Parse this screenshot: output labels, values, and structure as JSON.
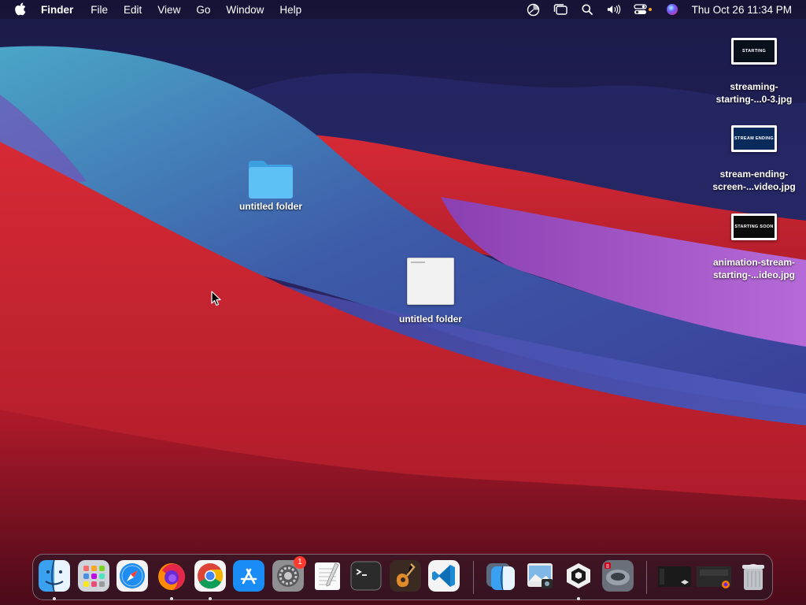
{
  "menubar": {
    "app_name": "Finder",
    "items": [
      "File",
      "Edit",
      "View",
      "Go",
      "Window",
      "Help"
    ],
    "status_icons": [
      "screen-time-icon",
      "stage-manager-icon",
      "search-icon",
      "volume-icon",
      "control-center-icon",
      "siri-icon"
    ],
    "clock": "Thu Oct 26  11:34 PM"
  },
  "desktop": {
    "folder1": {
      "label": "untitled folder"
    },
    "folder2": {
      "label": "untitled folder"
    },
    "files": [
      {
        "line1": "streaming-",
        "line2": "starting-...0-3.jpg",
        "thumb_text": "STARTING",
        "thumb_color": "#0a0f1c"
      },
      {
        "line1": "stream-ending-",
        "line2": "screen-...video.jpg",
        "thumb_text": "STREAM ENDING",
        "thumb_color": "#0a2a5c"
      },
      {
        "line1": "animation-stream-",
        "line2": "starting-...ideo.jpg",
        "thumb_text": "STARTING SOON",
        "thumb_color": "#0c0c0c"
      }
    ]
  },
  "dock": {
    "apps": [
      "finder-icon",
      "launchpad-icon",
      "safari-icon",
      "firefox-icon",
      "chrome-icon",
      "app-store-icon",
      "system-preferences-icon",
      "textedit-icon",
      "terminal-icon",
      "garageband-icon",
      "vscode-icon",
      "finder-alt-icon",
      "preview-icon",
      "unity-hub-icon",
      "game-app-icon",
      "minimized-window-1",
      "minimized-window-2",
      "trash-icon"
    ],
    "system_prefs_badge": "1"
  },
  "colors": {
    "menubar_bg": "#1a1230",
    "folder_blue": "#4fb3f0",
    "accent_red": "#d12a2a"
  }
}
